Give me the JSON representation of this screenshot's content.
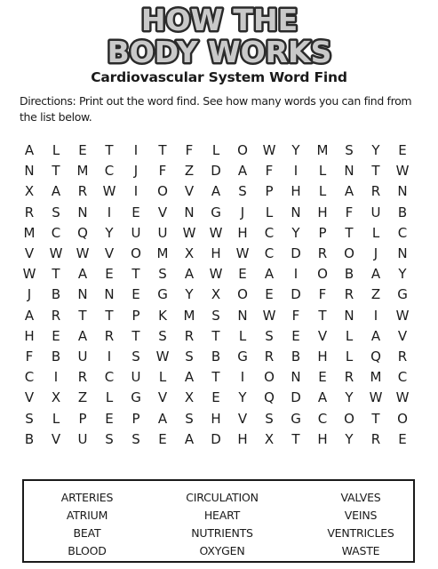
{
  "logo": {
    "line1": "HOW THE",
    "line2": "BODY WORKS"
  },
  "title": "Cardiovascular System Word Find",
  "directions": "Directions: Print out the word find. See how many words you can find from the list below.",
  "grid": [
    [
      "A",
      "L",
      "E",
      "T",
      "I",
      "T",
      "F",
      "L",
      "O",
      "W",
      "Y",
      "M",
      "S",
      "Y",
      "E"
    ],
    [
      "N",
      "T",
      "M",
      "C",
      "J",
      "F",
      "Z",
      "D",
      "A",
      "F",
      "I",
      "L",
      "N",
      "T",
      "W"
    ],
    [
      "X",
      "A",
      "R",
      "W",
      "I",
      "O",
      "V",
      "A",
      "S",
      "P",
      "H",
      "L",
      "A",
      "R",
      "N"
    ],
    [
      "R",
      "S",
      "N",
      "I",
      "E",
      "V",
      "N",
      "G",
      "J",
      "L",
      "N",
      "H",
      "F",
      "U",
      "B"
    ],
    [
      "M",
      "C",
      "Q",
      "Y",
      "U",
      "U",
      "W",
      "W",
      "H",
      "C",
      "Y",
      "P",
      "T",
      "L",
      "C"
    ],
    [
      "V",
      "W",
      "W",
      "V",
      "O",
      "M",
      "X",
      "H",
      "W",
      "C",
      "D",
      "R",
      "O",
      "J",
      "N"
    ],
    [
      "W",
      "T",
      "A",
      "E",
      "T",
      "S",
      "A",
      "W",
      "E",
      "A",
      "I",
      "O",
      "B",
      "A",
      "Y"
    ],
    [
      "J",
      "B",
      "N",
      "N",
      "E",
      "G",
      "Y",
      "X",
      "O",
      "E",
      "D",
      "F",
      "R",
      "Z",
      "G"
    ],
    [
      "A",
      "R",
      "T",
      "T",
      "P",
      "K",
      "M",
      "S",
      "N",
      "W",
      "F",
      "T",
      "N",
      "I",
      "W"
    ],
    [
      "H",
      "E",
      "A",
      "R",
      "T",
      "S",
      "R",
      "T",
      "L",
      "S",
      "E",
      "V",
      "L",
      "A",
      "V"
    ],
    [
      "F",
      "B",
      "U",
      "I",
      "S",
      "W",
      "S",
      "B",
      "G",
      "R",
      "B",
      "H",
      "L",
      "Q",
      "R"
    ],
    [
      "C",
      "I",
      "R",
      "C",
      "U",
      "L",
      "A",
      "T",
      "I",
      "O",
      "N",
      "E",
      "R",
      "M",
      "C"
    ],
    [
      "V",
      "X",
      "Z",
      "L",
      "G",
      "V",
      "X",
      "E",
      "Y",
      "Q",
      "D",
      "A",
      "Y",
      "W",
      "W"
    ],
    [
      "S",
      "L",
      "P",
      "E",
      "P",
      "A",
      "S",
      "H",
      "V",
      "S",
      "G",
      "C",
      "O",
      "T",
      "O"
    ],
    [
      "B",
      "V",
      "U",
      "S",
      "S",
      "E",
      "A",
      "D",
      "H",
      "X",
      "T",
      "H",
      "Y",
      "R",
      "E"
    ]
  ],
  "word_list": [
    [
      "ARTERIES",
      "ATRIUM",
      "BEAT",
      "BLOOD"
    ],
    [
      "CIRCULATION",
      "HEART",
      "NUTRIENTS",
      "OXYGEN"
    ],
    [
      "VALVES",
      "VEINS",
      "VENTRICLES",
      "WASTE"
    ]
  ]
}
